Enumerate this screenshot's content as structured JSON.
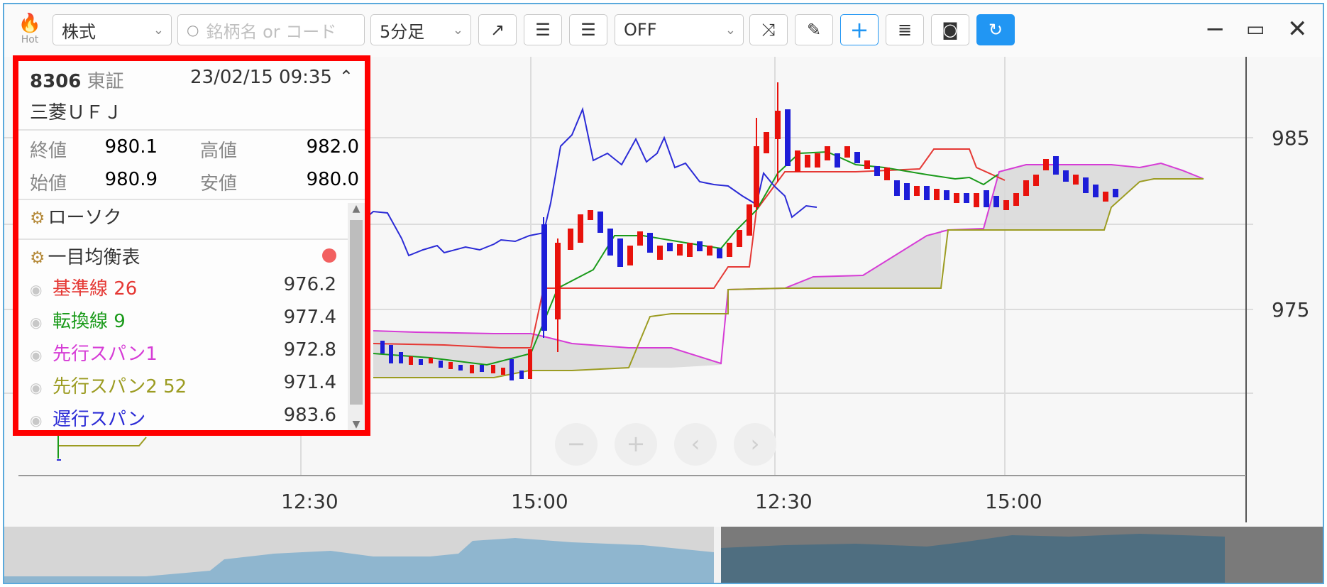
{
  "toolbar": {
    "hot_label": "Hot",
    "market_select": "株式",
    "search_placeholder": "銘柄名 or コード",
    "interval_select": "5分足",
    "indicator_select": "OFF"
  },
  "info": {
    "code": "8306",
    "exchange": "東証",
    "datetime": "23/02/15 09:35",
    "name": "三菱ＵＦＪ",
    "close_label": "終値",
    "close": "980.1",
    "high_label": "高値",
    "high": "982.0",
    "open_label": "始値",
    "open": "980.9",
    "low_label": "安値",
    "low": "980.0",
    "candle_label": "ローソク",
    "ichimoku_label": "一目均衡表",
    "lines": [
      {
        "label": "基準線 26",
        "value": "976.2",
        "color": "#e53935"
      },
      {
        "label": "転換線 9",
        "value": "977.4",
        "color": "#1a9a1a"
      },
      {
        "label": "先行スパン1",
        "value": "972.8",
        "color": "#d63cd6"
      },
      {
        "label": "先行スパン2 52",
        "value": "971.4",
        "color": "#9c9c22"
      },
      {
        "label": "遅行スパン",
        "value": "983.6",
        "color": "#2b2bd6"
      }
    ]
  },
  "axis": {
    "y_ticks": [
      "985",
      "975"
    ],
    "x_ticks": [
      "12:30",
      "15:00",
      "12:30",
      "15:00"
    ]
  },
  "colors": {
    "up": "#e8120c",
    "down": "#1d1dd8",
    "accent": "#2196f3",
    "highlight": "#ff0000"
  }
}
